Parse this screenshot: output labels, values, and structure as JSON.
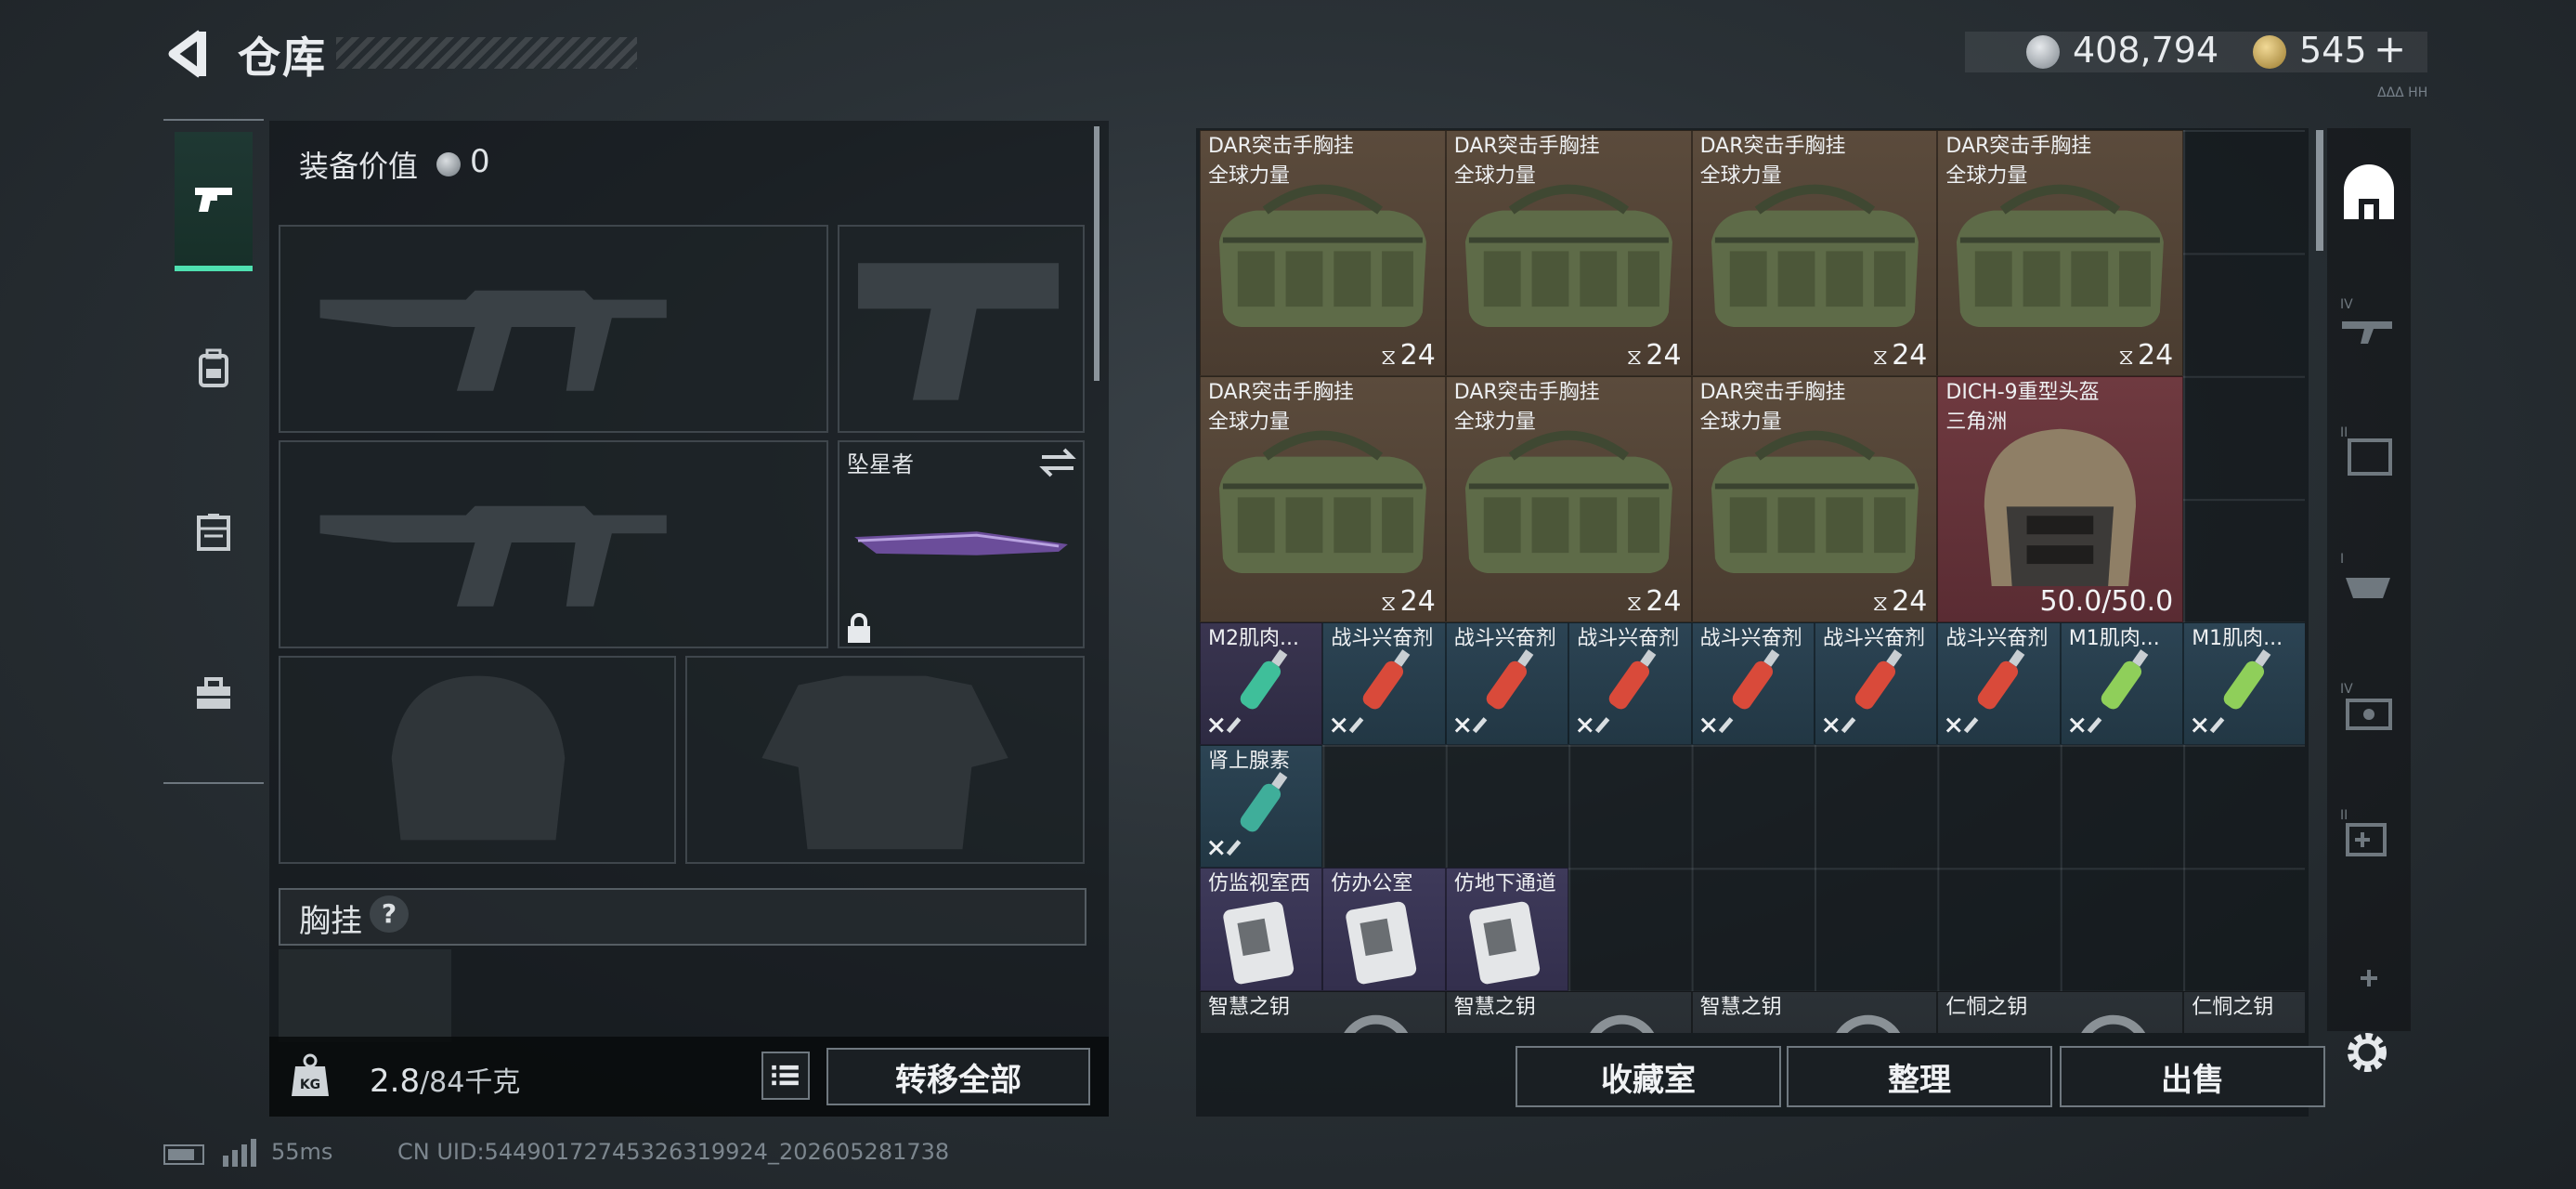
{
  "header": {
    "title": "仓库",
    "currency": {
      "silver": "408,794",
      "gold": "545",
      "gold_plus": "+"
    },
    "small_text": "ΔΔΔ ΗΗ"
  },
  "rail": {
    "tabs": [
      "pistol-icon",
      "backpack-icon",
      "locker-icon",
      "toolbox-icon"
    ],
    "active": 0
  },
  "loadout": {
    "equip_value_label": "装备价值",
    "equip_value": "0",
    "melee_name": "坠星者",
    "vest_label": "胸挂",
    "help": "?",
    "weight_current": "2.8",
    "weight_capacity": "/84千克",
    "transfer_all": "转移全部"
  },
  "stash": {
    "items": [
      {
        "name": "DAR突击手胸挂",
        "sub": "全球力量",
        "count": "24",
        "type": "bag"
      },
      {
        "name": "DAR突击手胸挂",
        "sub": "全球力量",
        "count": "24",
        "type": "bag"
      },
      {
        "name": "DAR突击手胸挂",
        "sub": "全球力量",
        "count": "24",
        "type": "bag"
      },
      {
        "name": "DAR突击手胸挂",
        "sub": "全球力量",
        "count": "24",
        "type": "bag"
      },
      {
        "name": "DAR突击手胸挂",
        "sub": "全球力量",
        "count": "24",
        "type": "bag"
      },
      {
        "name": "DAR突击手胸挂",
        "sub": "全球力量",
        "count": "24",
        "type": "bag"
      },
      {
        "name": "DAR突击手胸挂",
        "sub": "全球力量",
        "count": "24",
        "type": "bag"
      },
      {
        "name": "DICH-9重型头盔",
        "sub": "三角洲",
        "durability": "50.0/50.0",
        "type": "helmet"
      }
    ],
    "meds": [
      {
        "name": "M2肌肉...",
        "color": "#3fbf9a"
      },
      {
        "name": "战斗兴奋剂",
        "color": "#d94a3a"
      },
      {
        "name": "战斗兴奋剂",
        "color": "#d94a3a"
      },
      {
        "name": "战斗兴奋剂",
        "color": "#d94a3a"
      },
      {
        "name": "战斗兴奋剂",
        "color": "#d94a3a"
      },
      {
        "name": "战斗兴奋剂",
        "color": "#d94a3a"
      },
      {
        "name": "战斗兴奋剂",
        "color": "#d94a3a"
      },
      {
        "name": "M1肌肉...",
        "color": "#8fcf5a"
      },
      {
        "name": "M1肌肉...",
        "color": "#8fcf5a"
      },
      {
        "name": "肾上腺素",
        "color": "#3fae9a"
      }
    ],
    "keycards": [
      "仿监视室西",
      "仿办公室",
      "仿地下通道"
    ],
    "keys": [
      "智慧之钥",
      "智慧之钥",
      "智慧之钥",
      "仁恫之钥",
      "仁恫之钥"
    ],
    "buttons": {
      "collection": "收藏室",
      "sort": "整理",
      "sell": "出售"
    }
  },
  "right_rail": [
    "home-base-icon",
    "tier4-rifle-icon",
    "tier2-container-icon",
    "tier1-case-icon",
    "tier4-lock-icon",
    "tier2-medkit-icon",
    "add-icon"
  ],
  "status": {
    "ping": "55ms",
    "uid": "CN UID:5449017274532631992​4_202605281738"
  }
}
